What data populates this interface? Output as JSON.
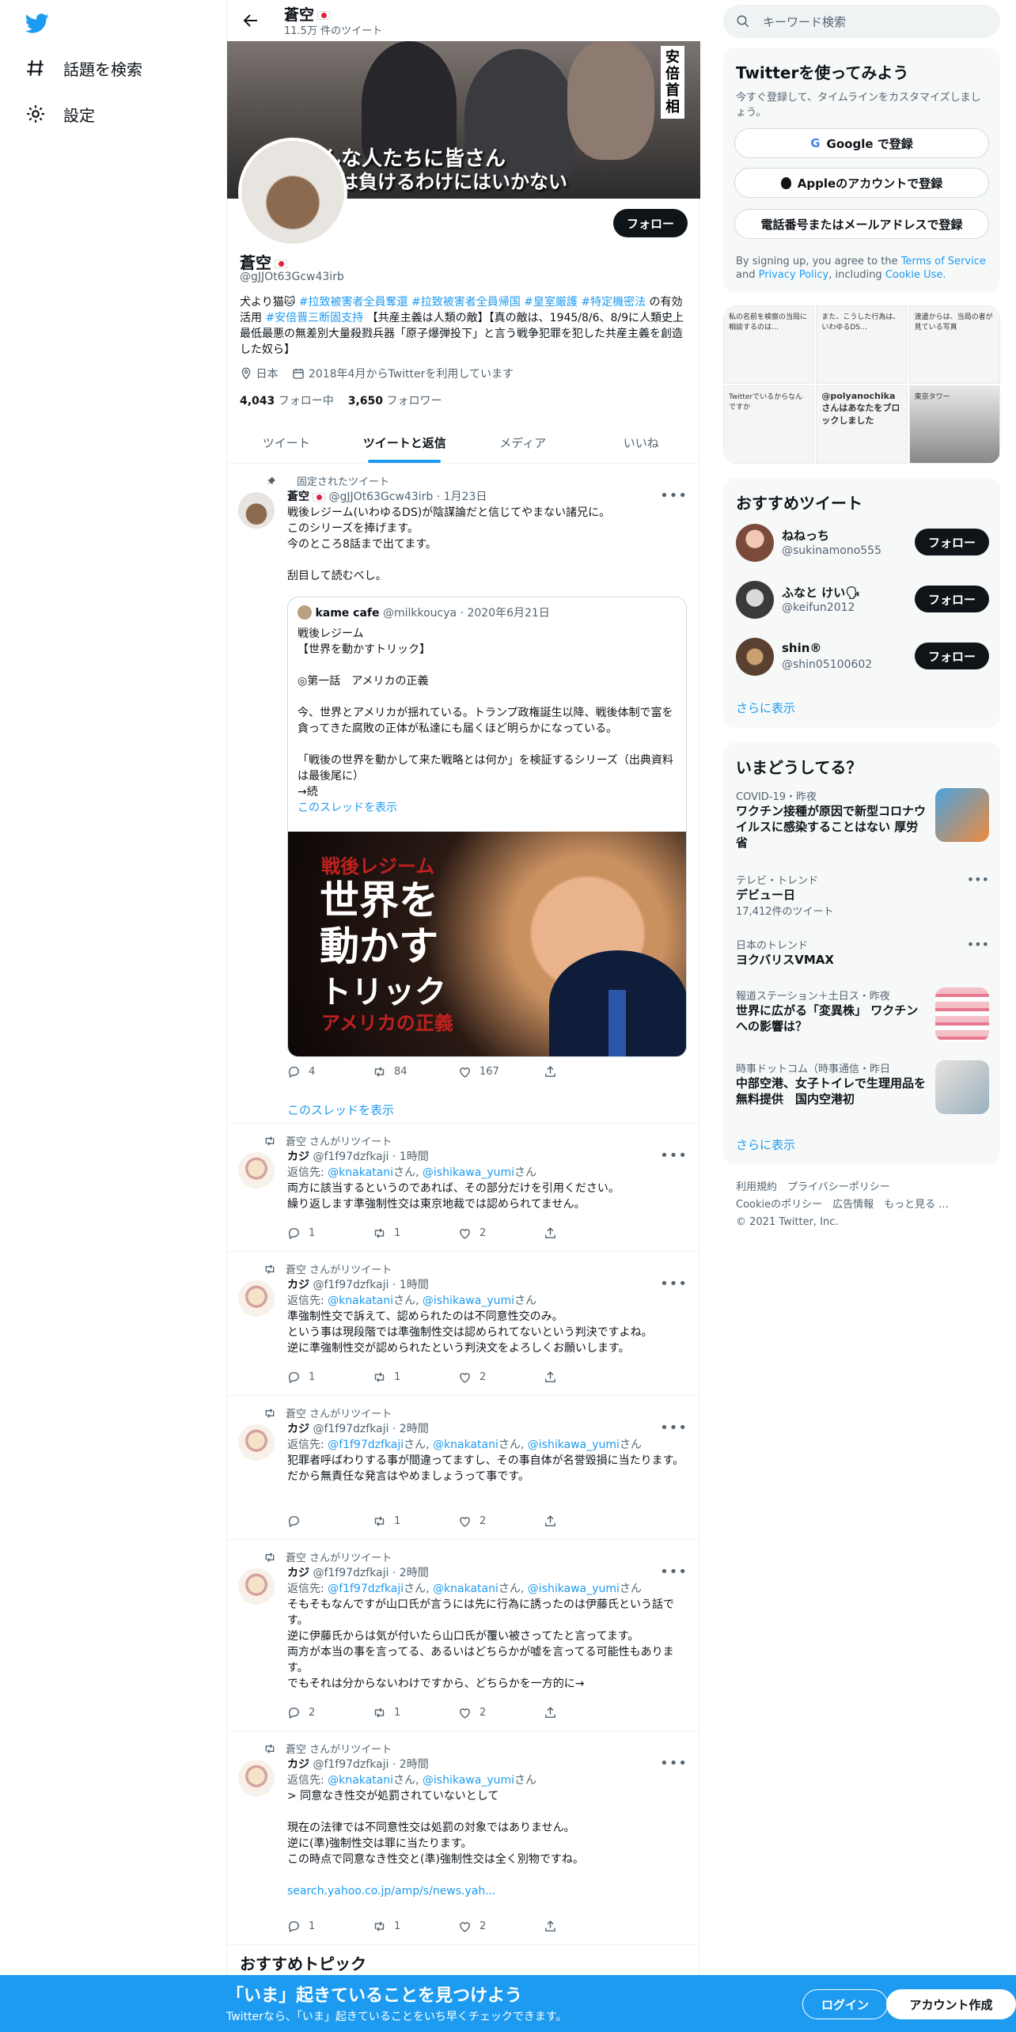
{
  "nav": {
    "items": [
      {
        "label": "話題を検索"
      },
      {
        "label": "設定"
      }
    ]
  },
  "profile": {
    "name": "蒼空",
    "tweet_count": "11.5万 件のツイート",
    "handle": "@gJJOt63Gcw43irb",
    "follow_label": "フォロー",
    "banner_caption1": "んな人たちに皆さん",
    "banner_caption2": "ちは負けるわけにはいかない",
    "banner_sign": "安倍首相",
    "bio_parts": [
      "犬より猫🐱",
      "#拉致被害者全員奪還",
      "#拉致被害者全員帰国",
      "#皇室厳護",
      "#特定機密法",
      "の有効活用",
      "#安倍晋三断固支持",
      "【共産主義は人類の敵】【真の敵は、1945/8/6、8/9に人類史上最低最悪の無差別大量殺戮兵器「原子爆弾投下」と言う戦争犯罪を犯した共産主義を創造した奴ら】"
    ],
    "location": "日本",
    "joined": "2018年4月からTwitterを利用しています",
    "following_count": "4,043",
    "following_label": "フォロー中",
    "followers_count": "3,650",
    "followers_label": "フォロワー"
  },
  "tabs": [
    "ツイート",
    "ツイートと返信",
    "メディア",
    "いいね"
  ],
  "pinned": {
    "context": "固定されたツイート",
    "name": "蒼空",
    "handle": "@gJJOt63Gcw43irb",
    "time": "1月23日",
    "text": [
      "戦後レジーム(いわゆるDS)が陰謀論だと信じてやまない諸兄に。",
      "このシリーズを捧げます。",
      "今のところ8話まで出てます。",
      "",
      "刮目して読むべし。"
    ],
    "quote": {
      "name": "kame cafe",
      "handle": "@milkkoucya",
      "time": "2020年6月21日",
      "lines": [
        "戦後レジーム",
        "【世界を動かすトリック】",
        "",
        "◎第一話　アメリカの正義",
        "",
        "今、世界とアメリカが揺れている。トランプ政権誕生以降、戦後体制で富を貪ってきた腐敗の正体が私達にも届くほど明らかになっている。",
        "",
        "「戦後の世界を動かして来た戦略とは何か」を検証するシリーズ（出典資料は最後尾に）",
        "→続"
      ],
      "show_thread": "このスレッドを表示",
      "img_t1": "戦後レジーム",
      "img_t2a": "世界を",
      "img_t2b": "動かす",
      "img_t2c": "トリック",
      "img_t3": "アメリカの正義"
    },
    "replies": "4",
    "retweets": "84",
    "likes": "167",
    "show_thread": "このスレッドを表示"
  },
  "retweets": [
    {
      "context": "蒼空 さんがリツイート",
      "name": "カジ",
      "handle": "@f1f97dzfkaji",
      "time": "1時間",
      "reply_prefix": "返信先:",
      "reply_to": [
        "@knakatani",
        "@ishikawa_yumi"
      ],
      "san": "さん",
      "lines": [
        "両方に該当するというのであれば、その部分だけを引用ください。",
        "繰り返します準強制性交は東京地裁では認められてません。"
      ],
      "replies": "1",
      "retweets": "1",
      "likes": "2"
    },
    {
      "context": "蒼空 さんがリツイート",
      "name": "カジ",
      "handle": "@f1f97dzfkaji",
      "time": "1時間",
      "reply_prefix": "返信先:",
      "reply_to": [
        "@knakatani",
        "@ishikawa_yumi"
      ],
      "san": "さん",
      "lines": [
        "準強制性交で訴えて、認められたのは不同意性交のみ。",
        "という事は現段階では準強制性交は認められてないという判決ですよね。",
        "逆に準強制性交が認められたという判決文をよろしくお願いします。"
      ],
      "replies": "1",
      "retweets": "1",
      "likes": "2"
    },
    {
      "context": "蒼空 さんがリツイート",
      "name": "カジ",
      "handle": "@f1f97dzfkaji",
      "time": "2時間",
      "reply_prefix": "返信先:",
      "reply_to": [
        "@f1f97dzfkaji",
        "@knakatani",
        "@ishikawa_yumi"
      ],
      "san": "さん",
      "lines": [
        "犯罪者呼ばわりする事が間違ってますし、その事自体が名誉毀損に当たります。",
        "だから無責任な発言はやめましょうって事です。"
      ],
      "replies": "",
      "retweets": "1",
      "likes": "2"
    },
    {
      "context": "蒼空 さんがリツイート",
      "name": "カジ",
      "handle": "@f1f97dzfkaji",
      "time": "2時間",
      "reply_prefix": "返信先:",
      "reply_to": [
        "@f1f97dzfkaji",
        "@knakatani",
        "@ishikawa_yumi"
      ],
      "san": "さん",
      "lines": [
        "そもそもなんですが山口氏が言うには先に行為に誘ったのは伊藤氏という話です。",
        "逆に伊藤氏からは気が付いたら山口氏が覆い被さってたと言ってます。",
        "両方が本当の事を言ってる、あるいはどちらかが嘘を言ってる可能性もあります。",
        "でもそれは分からないわけですから、どちらかを一方的に→"
      ],
      "replies": "2",
      "retweets": "1",
      "likes": "2"
    },
    {
      "context": "蒼空 さんがリツイート",
      "name": "カジ",
      "handle": "@f1f97dzfkaji",
      "time": "2時間",
      "reply_prefix": "返信先:",
      "reply_to": [
        "@knakatani",
        "@ishikawa_yumi"
      ],
      "san": "さん",
      "lines": [
        "> 同意なき性交が処罰されていないとして",
        "",
        "現在の法律では不同意性交は処罰の対象ではありません。",
        "逆に(準)強制性交は罪に当たります。",
        "この時点で同意なき性交と(準)強制性交は全く別物ですね。"
      ],
      "link": "search.yahoo.co.jp/amp/s/news.yah...",
      "replies": "1",
      "retweets": "1",
      "likes": "2"
    }
  ],
  "suggested_topics": "おすすめトピック",
  "right": {
    "search_placeholder": "キーワード検索",
    "try": {
      "title": "Twitterを使ってみよう",
      "subtitle": "今すぐ登録して、タイムラインをカスタマイズしましょう。",
      "google": "Google で登録",
      "apple": "Appleのアカウントで登録",
      "phone": "電話番号またはメールアドレスで登録",
      "terms_prefix": "By signing up, you agree to the",
      "terms": "Terms of Service",
      "and": "and",
      "privacy": "Privacy Policy",
      "including": ", including",
      "cookie": "Cookie Use."
    },
    "media": [
      "私の名前を検察の当局に相談するのは…",
      "また、こうした行為は、いわゆるDS…",
      "渡邊からは、当局の者が見ている写真",
      "Twitterでいるからなんですか",
      "@polyanochikaさんはあなたをブロックしました",
      "東京タワー"
    ],
    "rec_title": "おすすめツイート",
    "recs": [
      {
        "name": "ねねっち",
        "handle": "@sukinamono555",
        "btn": "フォロー"
      },
      {
        "name": "ふなと けい🗣",
        "handle": "@keifun2012",
        "btn": "フォロー"
      },
      {
        "name": "shin®",
        "handle": "@shin05100602",
        "btn": "フォロー"
      }
    ],
    "show_more": "さらに表示",
    "trends_title": "いまどうしてる？",
    "trends": [
      {
        "cat": "COVID-19・昨夜",
        "title": "ワクチン接種が原因で新型コロナウイルスに感染することはない 厚労省",
        "count": ""
      },
      {
        "cat": "テレビ・トレンド",
        "title": "デビュー日",
        "count": "17,412件のツイート"
      },
      {
        "cat": "日本のトレンド",
        "title": "ヨクバリスVMAX",
        "count": ""
      },
      {
        "cat": "報道ステーション＋土日ス・昨夜",
        "title": "世界に広がる「変異株」 ワクチンへの影響は？",
        "count": ""
      },
      {
        "cat": "時事ドットコム（時事通信・昨日",
        "title": "中部空港、女子トイレで生理用品を無料提供　国内空港初",
        "count": ""
      }
    ],
    "footer": [
      "利用規約",
      "プライバシーポリシー",
      "Cookieのポリシー",
      "広告情報",
      "もっと見る ...",
      "© 2021 Twitter, Inc."
    ]
  },
  "bottom": {
    "headline": "「いま」起きていることを見つけよう",
    "sub": "Twitterなら、「いま」起きていることをいち早くチェックできます。",
    "login": "ログイン",
    "signup": "アカウント作成"
  },
  "colors": {
    "accent": "#1d9bf0",
    "text": "#0f1419",
    "muted": "#536471"
  }
}
